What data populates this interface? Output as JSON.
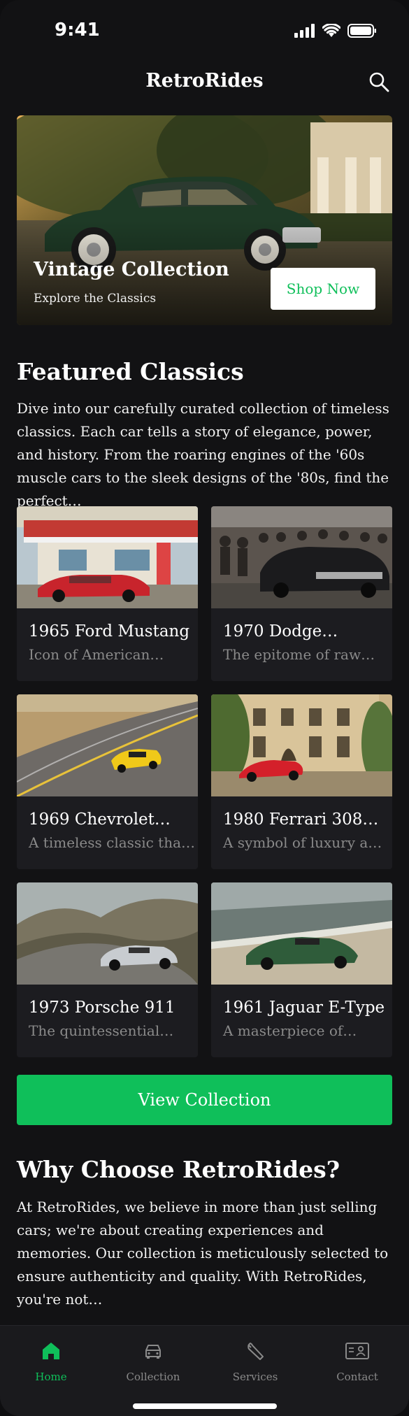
{
  "status": {
    "time": "9:41"
  },
  "header": {
    "title": "RetroRides",
    "search_icon": "search-icon"
  },
  "hero": {
    "title": "Vintage Collection",
    "subtitle": "Explore the Classics",
    "button": "Shop Now"
  },
  "featured": {
    "title": "Featured Classics",
    "text": "Dive into our carefully curated collection of timeless classics. Each car tells a story of elegance, power, and history. From the roaring engines of the '60s muscle cars to the sleek designs of the '80s, find the perfect…",
    "cards": [
      {
        "title": "1965 Ford Mustang",
        "desc": "Icon of American…"
      },
      {
        "title": "1970 Dodge…",
        "desc": "The epitome of raw…"
      },
      {
        "title": "1969 Chevrolet…",
        "desc": "A timeless classic tha…"
      },
      {
        "title": "1980 Ferrari 308…",
        "desc": "A symbol of luxury a…"
      },
      {
        "title": "1973 Porsche 911",
        "desc": "The quintessential…"
      },
      {
        "title": "1961 Jaguar E-Type",
        "desc": "A masterpiece of…"
      }
    ],
    "button": "View Collection"
  },
  "why": {
    "title": "Why Choose RetroRides?",
    "text": "At RetroRides, we believe in more than just selling cars; we're about creating experiences and memories. Our collection is meticulously selected to ensure authenticity and quality. With RetroRides, you're not…"
  },
  "tabs": [
    {
      "label": "Home",
      "icon": "home-icon",
      "active": true
    },
    {
      "label": "Collection",
      "icon": "car-icon",
      "active": false
    },
    {
      "label": "Services",
      "icon": "wrench-icon",
      "active": false
    },
    {
      "label": "Contact",
      "icon": "contact-card-icon",
      "active": false
    }
  ],
  "colors": {
    "accent": "#0fbf5a",
    "background": "#121214",
    "card": "#1c1c20",
    "muted": "#8a8a8a"
  }
}
